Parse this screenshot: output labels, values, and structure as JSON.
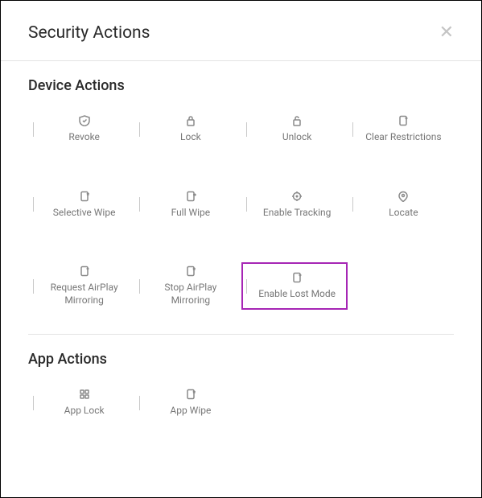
{
  "header": {
    "title": "Security Actions",
    "close": "✕"
  },
  "deviceActions": {
    "title": "Device Actions",
    "items": [
      {
        "label": "Revoke"
      },
      {
        "label": "Lock"
      },
      {
        "label": "Unlock"
      },
      {
        "label": "Clear Restrictions"
      },
      {
        "label": "Selective Wipe"
      },
      {
        "label": "Full Wipe"
      },
      {
        "label": "Enable Tracking"
      },
      {
        "label": "Locate"
      },
      {
        "label": "Request AirPlay Mirroring"
      },
      {
        "label": "Stop AirPlay Mirroring"
      },
      {
        "label": "Enable Lost Mode"
      }
    ]
  },
  "appActions": {
    "title": "App Actions",
    "items": [
      {
        "label": "App Lock"
      },
      {
        "label": "App Wipe"
      }
    ]
  }
}
